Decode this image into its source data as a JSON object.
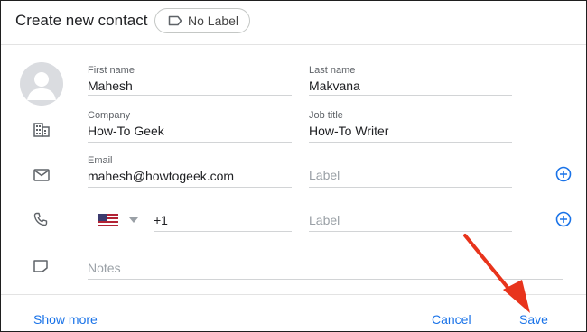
{
  "header": {
    "title": "Create new contact",
    "label_chip": "No Label"
  },
  "fields": {
    "first_name": {
      "label": "First name",
      "value": "Mahesh"
    },
    "last_name": {
      "label": "Last name",
      "value": "Makvana"
    },
    "company": {
      "label": "Company",
      "value": "How-To Geek"
    },
    "job_title": {
      "label": "Job title",
      "value": "How-To Writer"
    },
    "email": {
      "label": "Email",
      "value": "mahesh@howtogeek.com",
      "label_placeholder": "Label"
    },
    "phone": {
      "country_code": "+1",
      "label_placeholder": "Label"
    },
    "notes": {
      "placeholder": "Notes"
    }
  },
  "footer": {
    "show_more": "Show more",
    "cancel": "Cancel",
    "save": "Save"
  },
  "colors": {
    "accent": "#1a73e8",
    "arrow": "#e8341c"
  }
}
